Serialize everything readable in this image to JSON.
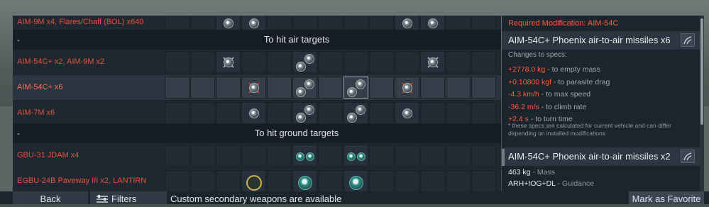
{
  "table": {
    "rows": [
      {
        "label": "AIM-9M x4,  Flares/Chaff (BOL) x640"
      },
      {
        "separator": "-",
        "title": "To hit air targets"
      },
      {
        "label": "AIM-54C+ x2,  AIM-9M x2"
      },
      {
        "label": "AIM-54C+ x6"
      },
      {
        "label": "AIM-7M x6"
      },
      {
        "separator": "-",
        "title": "To hit ground targets"
      },
      {
        "label": "GBU-31 JDAM x4"
      },
      {
        "label": "EGBU-24B Paveway III x2,  LANTIRN"
      }
    ],
    "selected_row": "AIM-54C+ x6"
  },
  "panel": {
    "required_modification": "Required Modification: AIM-54C",
    "card1": {
      "title": "AIM-54C+ Phoenix air-to-air missiles x6",
      "changes_label": "Changes to specs:",
      "specs": [
        {
          "value": "+2778.0 kg",
          "desc": " - to empty mass"
        },
        {
          "value": "+0.10800 kgf",
          "desc": " - to parasite drag"
        },
        {
          "value": "-4.3 km/h",
          "desc": " - to max speed"
        },
        {
          "value": "-36.2 m/s",
          "desc": " - to climb rate"
        },
        {
          "value": "+2.4 s",
          "desc": " - to turn time"
        }
      ],
      "note": "* these specs are calculated for current vehicle and can differ depending on installed modifications"
    },
    "card2": {
      "title": "AIM-54C+ Phoenix air-to-air missiles x2",
      "props": [
        {
          "value": "463 kg",
          "desc": " - Mass"
        },
        {
          "value": "ARH+IOG+DL",
          "desc": " - Guidance"
        }
      ]
    }
  },
  "bottom": {
    "back_label": "Back",
    "filters_label": "Filters",
    "status_text": "Custom secondary weapons are available",
    "favorite_label": "Mark as Favorite"
  },
  "colors": {
    "accent_red": "#ff5a3c",
    "panel_bg": "#1c242d",
    "text_light": "#e8edf1"
  },
  "icons": [
    "missile-icon",
    "bomb-icon",
    "graph-icon",
    "filters-icon"
  ]
}
